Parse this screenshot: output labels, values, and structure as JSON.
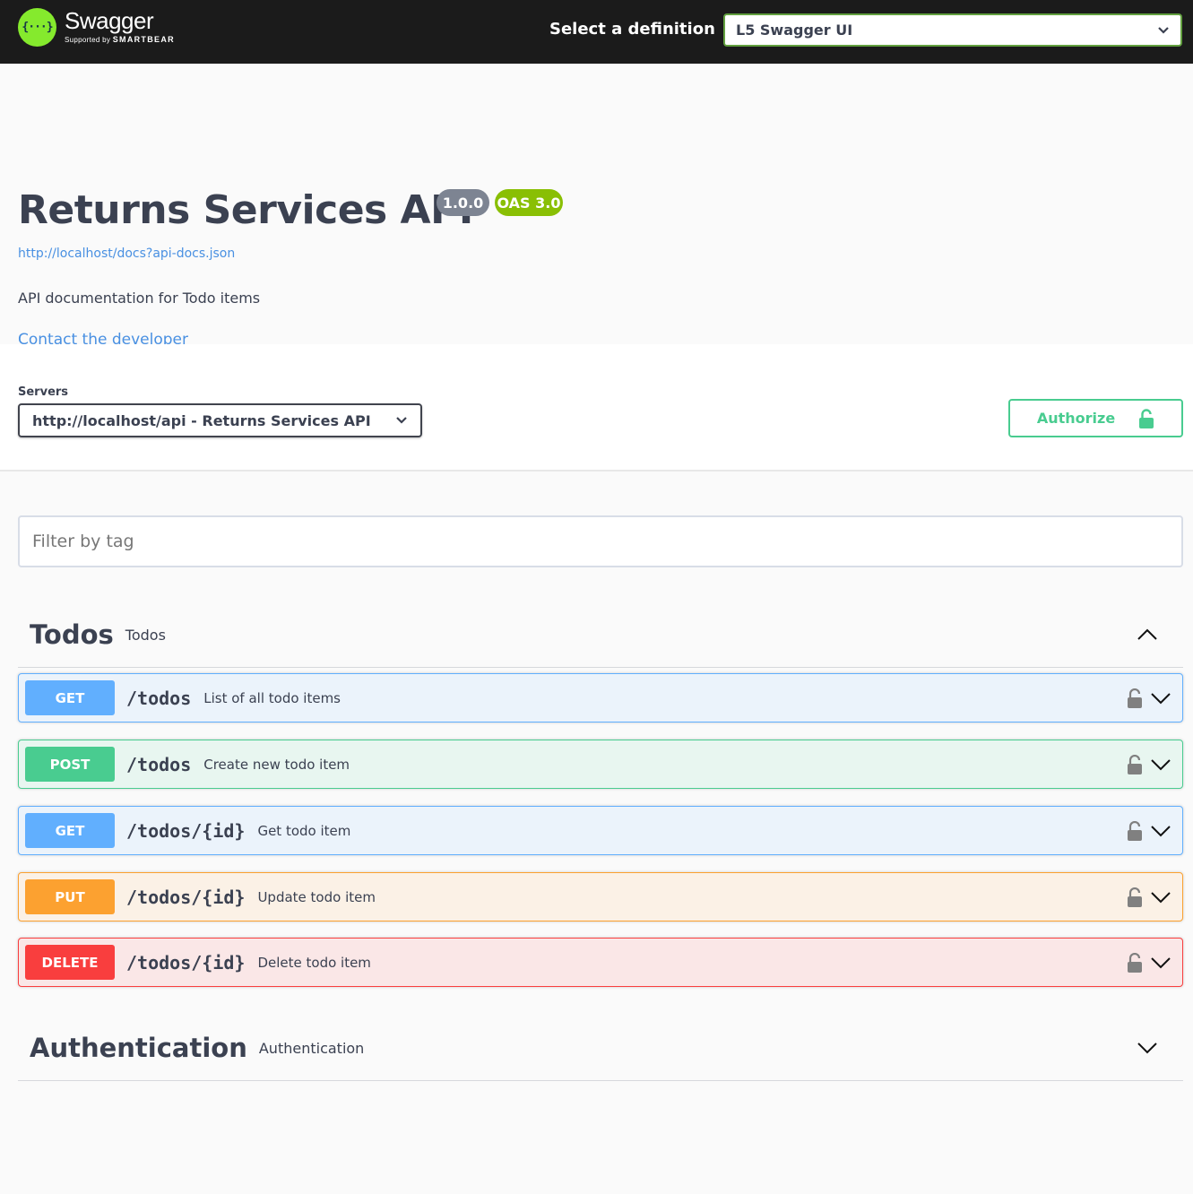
{
  "topbar": {
    "logo_icon_text": "{···}",
    "logo_name": "Swagger",
    "logo_sub_prefix": "Supported by",
    "logo_sub_brand": "SMARTBEAR",
    "definition_label": "Select a definition",
    "definition_selected": "L5 Swagger UI"
  },
  "info": {
    "title": "Returns Services API",
    "version": "1.0.0",
    "oas": "OAS 3.0",
    "docs_url": "http://localhost/docs?api-docs.json",
    "description": "API documentation for Todo items",
    "contact": "Contact the developer"
  },
  "servers": {
    "label": "Servers",
    "selected": "http://localhost/api - Returns Services API",
    "authorize_label": "Authorize"
  },
  "filter": {
    "placeholder": "Filter by tag"
  },
  "tags": [
    {
      "name": "Todos",
      "description": "Todos",
      "expanded": true,
      "operations": [
        {
          "method": "GET",
          "path": "/todos",
          "summary": "List of all todo items"
        },
        {
          "method": "POST",
          "path": "/todos",
          "summary": "Create new todo item"
        },
        {
          "method": "GET",
          "path": "/todos/{id}",
          "summary": "Get todo item"
        },
        {
          "method": "PUT",
          "path": "/todos/{id}",
          "summary": "Update todo item"
        },
        {
          "method": "DELETE",
          "path": "/todos/{id}",
          "summary": "Delete todo item"
        }
      ]
    },
    {
      "name": "Authentication",
      "description": "Authentication",
      "expanded": false
    }
  ],
  "colors": {
    "get": "#61affe",
    "post": "#49cc90",
    "put": "#fca130",
    "delete": "#f93e3e",
    "accent": "#85ea2d",
    "link": "#4990e2"
  }
}
